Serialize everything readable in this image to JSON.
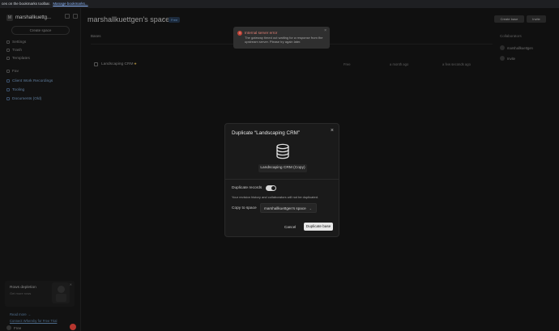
{
  "bookmarks_bar": {
    "text": "ces on the bookmarks toolbar.",
    "link": "Manage bookmarks..."
  },
  "sidebar": {
    "workspace_name": "marshallkuettg...",
    "avatar_letter": "M",
    "create_label": "Create space",
    "items": [
      {
        "label": "Settings"
      },
      {
        "label": "Trash"
      },
      {
        "label": "Templates"
      }
    ],
    "section_label": "Fav",
    "links": [
      {
        "label": "Client Work Recordings"
      },
      {
        "label": "Tooling"
      },
      {
        "label": "Documents (Old)"
      }
    ],
    "promo_title": "Rows depletion",
    "promo_sub": "Get more rows",
    "promo_link_1": "Read more →",
    "promo_link_2": "Connect Whereby for Free Trial",
    "user_name": "Free"
  },
  "header": {
    "workspace_title": "marshallkuettgen's space",
    "plan_tag": "Free",
    "btn_create": "Create base",
    "btn_invite": "Invite"
  },
  "list": {
    "filter_label": "Bases",
    "base_name": "Landscaping CRM",
    "cell_owner": "Free",
    "cell_created": "a month ago",
    "cell_opened": "a few seconds ago"
  },
  "collaborators": {
    "title": "Collaborators",
    "user_1": "marshallkuettgen",
    "user_2": "Invite"
  },
  "toast": {
    "title": "Internal server error",
    "body": "The gateway timed out waiting for a response from the upstream server. Please try again later."
  },
  "modal": {
    "title": "Duplicate “Landscaping CRM”",
    "new_name": "Landscaping CRM (Copy)",
    "dup_records_label": "Duplicate records",
    "dup_records_on": true,
    "note": "Your revision history and collaborators will not be duplicated.",
    "copy_to_label": "Copy to space",
    "selected_space": "marshallkuettgen's space",
    "cancel_label": "Cancel",
    "confirm_label": "Duplicate base"
  },
  "colors": {
    "error": "#c04438",
    "primary_button": "#e8e8e8"
  }
}
